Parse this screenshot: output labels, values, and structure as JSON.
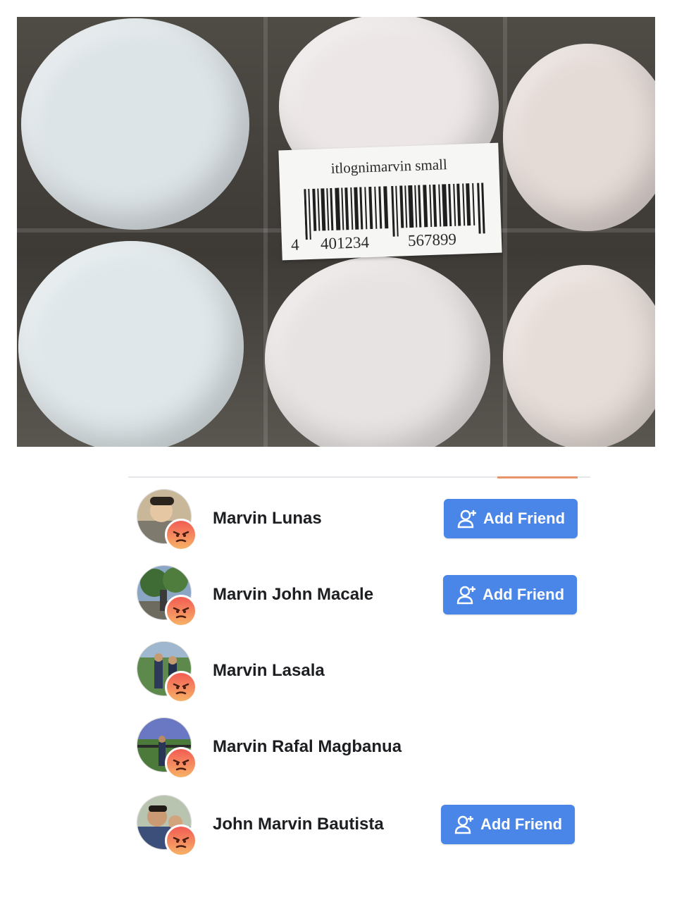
{
  "photo": {
    "label_text": "itlognimarvin small",
    "barcode_digit_lead": "4",
    "barcode_digits_left": "401234",
    "barcode_digits_right": "567899"
  },
  "friends": [
    {
      "name": "Marvin Lunas",
      "button": "Add Friend",
      "reaction": "angry-icon"
    },
    {
      "name": "Marvin John Macale",
      "button": "Add Friend",
      "reaction": "angry-icon"
    },
    {
      "name": "Marvin Lasala",
      "reaction": "angry-icon"
    },
    {
      "name": "Marvin Rafal Magbanua",
      "reaction": "angry-icon"
    },
    {
      "name": "John Marvin Bautista",
      "button": "Add Friend",
      "reaction": "angry-icon"
    }
  ],
  "colors": {
    "button_blue": "#4a86e8",
    "reaction_top": "#f25c54",
    "reaction_bottom": "#f7b267"
  }
}
